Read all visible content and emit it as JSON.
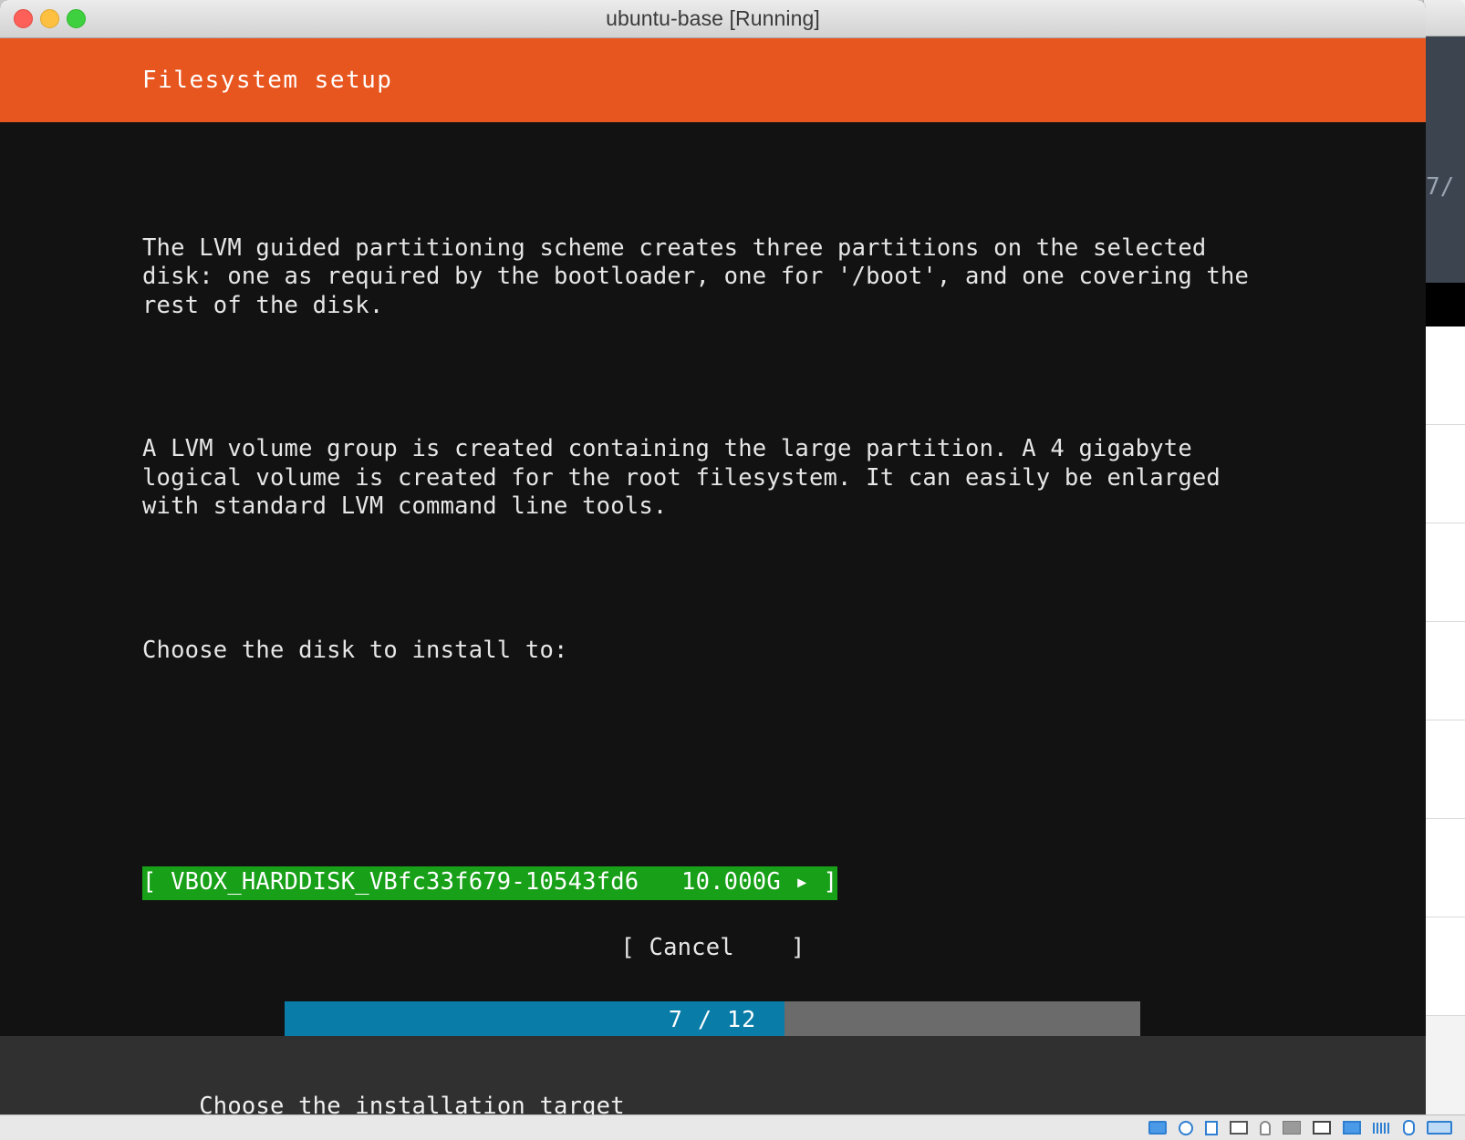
{
  "window": {
    "title": "ubuntu-base [Running]",
    "controls": {
      "close": "close-button",
      "minimize": "minimize-button",
      "maximize": "maximize-button"
    }
  },
  "header": {
    "title": "Filesystem setup",
    "background_color": "#e8561f",
    "text_color": "#ffffff"
  },
  "body": {
    "paragraph_1_line_1": "The LVM guided partitioning scheme creates three partitions on the selected",
    "paragraph_1_line_2": "disk: one as required by the bootloader, one for '/boot', and one covering the",
    "paragraph_1_line_3": "rest of the disk.",
    "paragraph_2_line_1": "A LVM volume group is created containing the large partition. A 4 gigabyte",
    "paragraph_2_line_2": "logical volume is created for the root filesystem. It can easily be enlarged",
    "paragraph_2_line_3": "with standard LVM command line tools.",
    "prompt": "Choose the disk to install to:"
  },
  "disk_selector": {
    "open_bracket": "[ ",
    "label": "VBOX_HARDDISK_VBfc33f679-10543fd6",
    "spacer": "   ",
    "size": "10.000G",
    "arrow": " ▸ ",
    "close_bracket": "]",
    "selected": true,
    "highlight_color": "#18a018",
    "text_color": "#ffffff"
  },
  "buttons": {
    "cancel": "[ Cancel    ]"
  },
  "progress": {
    "current_step": 7,
    "total_steps": 12,
    "label": "7 / 12",
    "fill_color": "#0a7ca8",
    "track_color": "#6b6b6b",
    "percent": 58
  },
  "footer": {
    "status_text": "Choose the installation target",
    "background_color": "#303030"
  },
  "vbox_statusbar": {
    "icons": [
      "hard-disk-icon",
      "optical-disk-icon",
      "floppy-disk-icon",
      "network-icon",
      "usb-icon",
      "shared-folder-icon",
      "display-icon",
      "recording-icon",
      "keyboard-icon",
      "mouse-icon",
      "host-key-icon"
    ]
  }
}
